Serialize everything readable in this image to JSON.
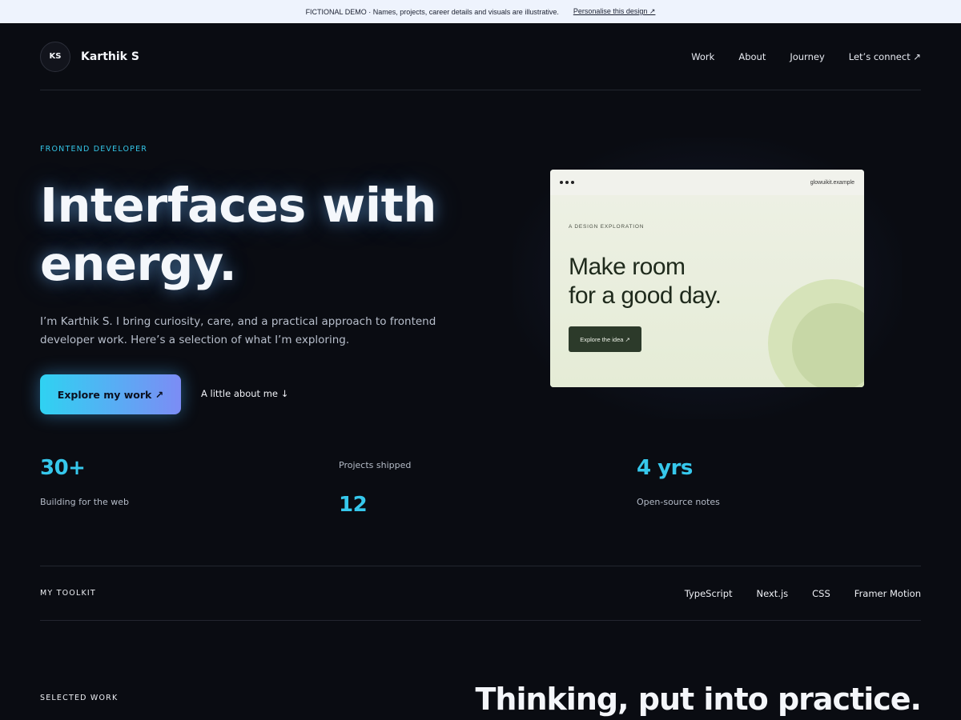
{
  "banner": {
    "notice": "FICTIONAL DEMO · Names, projects, career details and visuals are illustrative.",
    "link": "Personalise this design ↗"
  },
  "nav": {
    "initials": "KS",
    "name": "Karthik S",
    "links": [
      "Work",
      "About",
      "Journey",
      "Let’s connect ↗"
    ]
  },
  "hero": {
    "eyebrow": "FRONTEND DEVELOPER",
    "title_line1": "Interfaces with",
    "title_line2": "energy.",
    "subtitle": "I’m Karthik S. I bring curiosity, care, and a practical approach to frontend developer work. Here’s a selection of what I’m exploring.",
    "primary_cta": "Explore my work ↗",
    "secondary_cta": "A little about me ↓"
  },
  "preview": {
    "url": "glowuikit.example",
    "eyebrow": "A DESIGN EXPLORATION",
    "title_line1": "Make room",
    "title_line2": "for a good day.",
    "button": "Explore the idea ↗"
  },
  "stats": [
    {
      "value": "30+",
      "label": "Building for the web"
    },
    {
      "value": "12",
      "label": "Projects shipped"
    },
    {
      "value": "4 yrs",
      "label": "Open-source notes"
    }
  ],
  "toolkit": {
    "label": "MY TOOLKIT",
    "tools": [
      "TypeScript",
      "Next.js",
      "CSS",
      "Framer Motion"
    ]
  },
  "work": {
    "eyebrow": "SELECTED WORK",
    "title": "Thinking, put into practice."
  },
  "colors": {
    "background": "#0a0c12",
    "accent": "#36c8ec",
    "gradient_start": "#2fd2f2",
    "gradient_end": "#7c8cf5"
  }
}
